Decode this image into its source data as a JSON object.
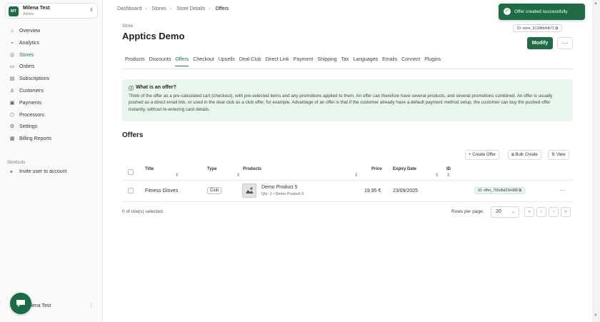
{
  "sidebar": {
    "workspace": {
      "initials": "MT",
      "name": "Milena Test",
      "role": "Admin"
    },
    "nav": [
      {
        "label": "Overview",
        "icon": "overview-icon",
        "glyph": "⌂"
      },
      {
        "label": "Analytics",
        "icon": "analytics-icon",
        "glyph": "⌁"
      },
      {
        "label": "Stores",
        "icon": "stores-icon",
        "glyph": "◎",
        "active": true
      },
      {
        "label": "Orders",
        "icon": "orders-icon",
        "glyph": "▭"
      },
      {
        "label": "Subscriptions",
        "icon": "subscriptions-icon",
        "glyph": "▤"
      },
      {
        "label": "Customers",
        "icon": "customers-icon",
        "glyph": "♙"
      },
      {
        "label": "Payments",
        "icon": "payments-icon",
        "glyph": "▣"
      },
      {
        "label": "Processors",
        "icon": "processors-icon",
        "glyph": "⬡"
      },
      {
        "label": "Settings",
        "icon": "settings-icon",
        "glyph": "⚙"
      },
      {
        "label": "Billing Reports",
        "icon": "billing-icon",
        "glyph": "▦"
      }
    ],
    "shortcuts_label": "Shortcuts",
    "shortcut": "Invite user to account",
    "footer_user": "Milena Test"
  },
  "breadcrumb": [
    "Dashboard",
    "Stores",
    "Store Details",
    "Offers"
  ],
  "header": {
    "label": "Store",
    "title": "Apptics Demo",
    "id_badge": "ID: store_912dfdefdb71",
    "modify_label": "Modify",
    "more_label": "···"
  },
  "tabs": [
    "Products",
    "Discounts",
    "Offers",
    "Checkout",
    "Upsells",
    "Deal Club",
    "Direct Link",
    "Payment",
    "Shipping",
    "Tax",
    "Languages",
    "Emails",
    "Connect",
    "Plugins"
  ],
  "active_tab": "Offers",
  "info": {
    "title": "What is an offer?",
    "text": "Think of the offer as a pre-calculated cart (checkout), with pre-selected items and any promotions applied to them. An offer can therefore have several products, and several promotions combined. An offer is usually pushed as a direct email link, or used in the deal club as a club offer, for example. Advantage of an offer is that if the customer already have a default payment method setup, the customer can buy the pushed offer instantly, without re-entering card details."
  },
  "offers": {
    "title": "Offers",
    "create_label": "Create Offer",
    "bulk_label": "Bulk Create",
    "view_label": "View",
    "columns": {
      "title": "Title",
      "type": "Type",
      "products": "Products",
      "price": "Price",
      "expiry": "Expiry Date",
      "id": "ID"
    },
    "rows": [
      {
        "title": "Fitness Gloves",
        "type": "Club",
        "product_name": "Demo Product 5",
        "product_sub": "Qty: 1  •  Demo Product 5",
        "price": "19,95 €",
        "expiry": "23/09/2025",
        "id": "ID: offer_755d5d23e988"
      }
    ],
    "selection_text": "0 of row(s) selected.",
    "rows_per_page_label": "Rows per page:",
    "rows_per_page": "20"
  },
  "toast": {
    "text": "Offer created successfully"
  },
  "colors": {
    "brand": "#1f6b45",
    "accent": "#1f7a4c",
    "info_bg": "#e9f6ee"
  }
}
